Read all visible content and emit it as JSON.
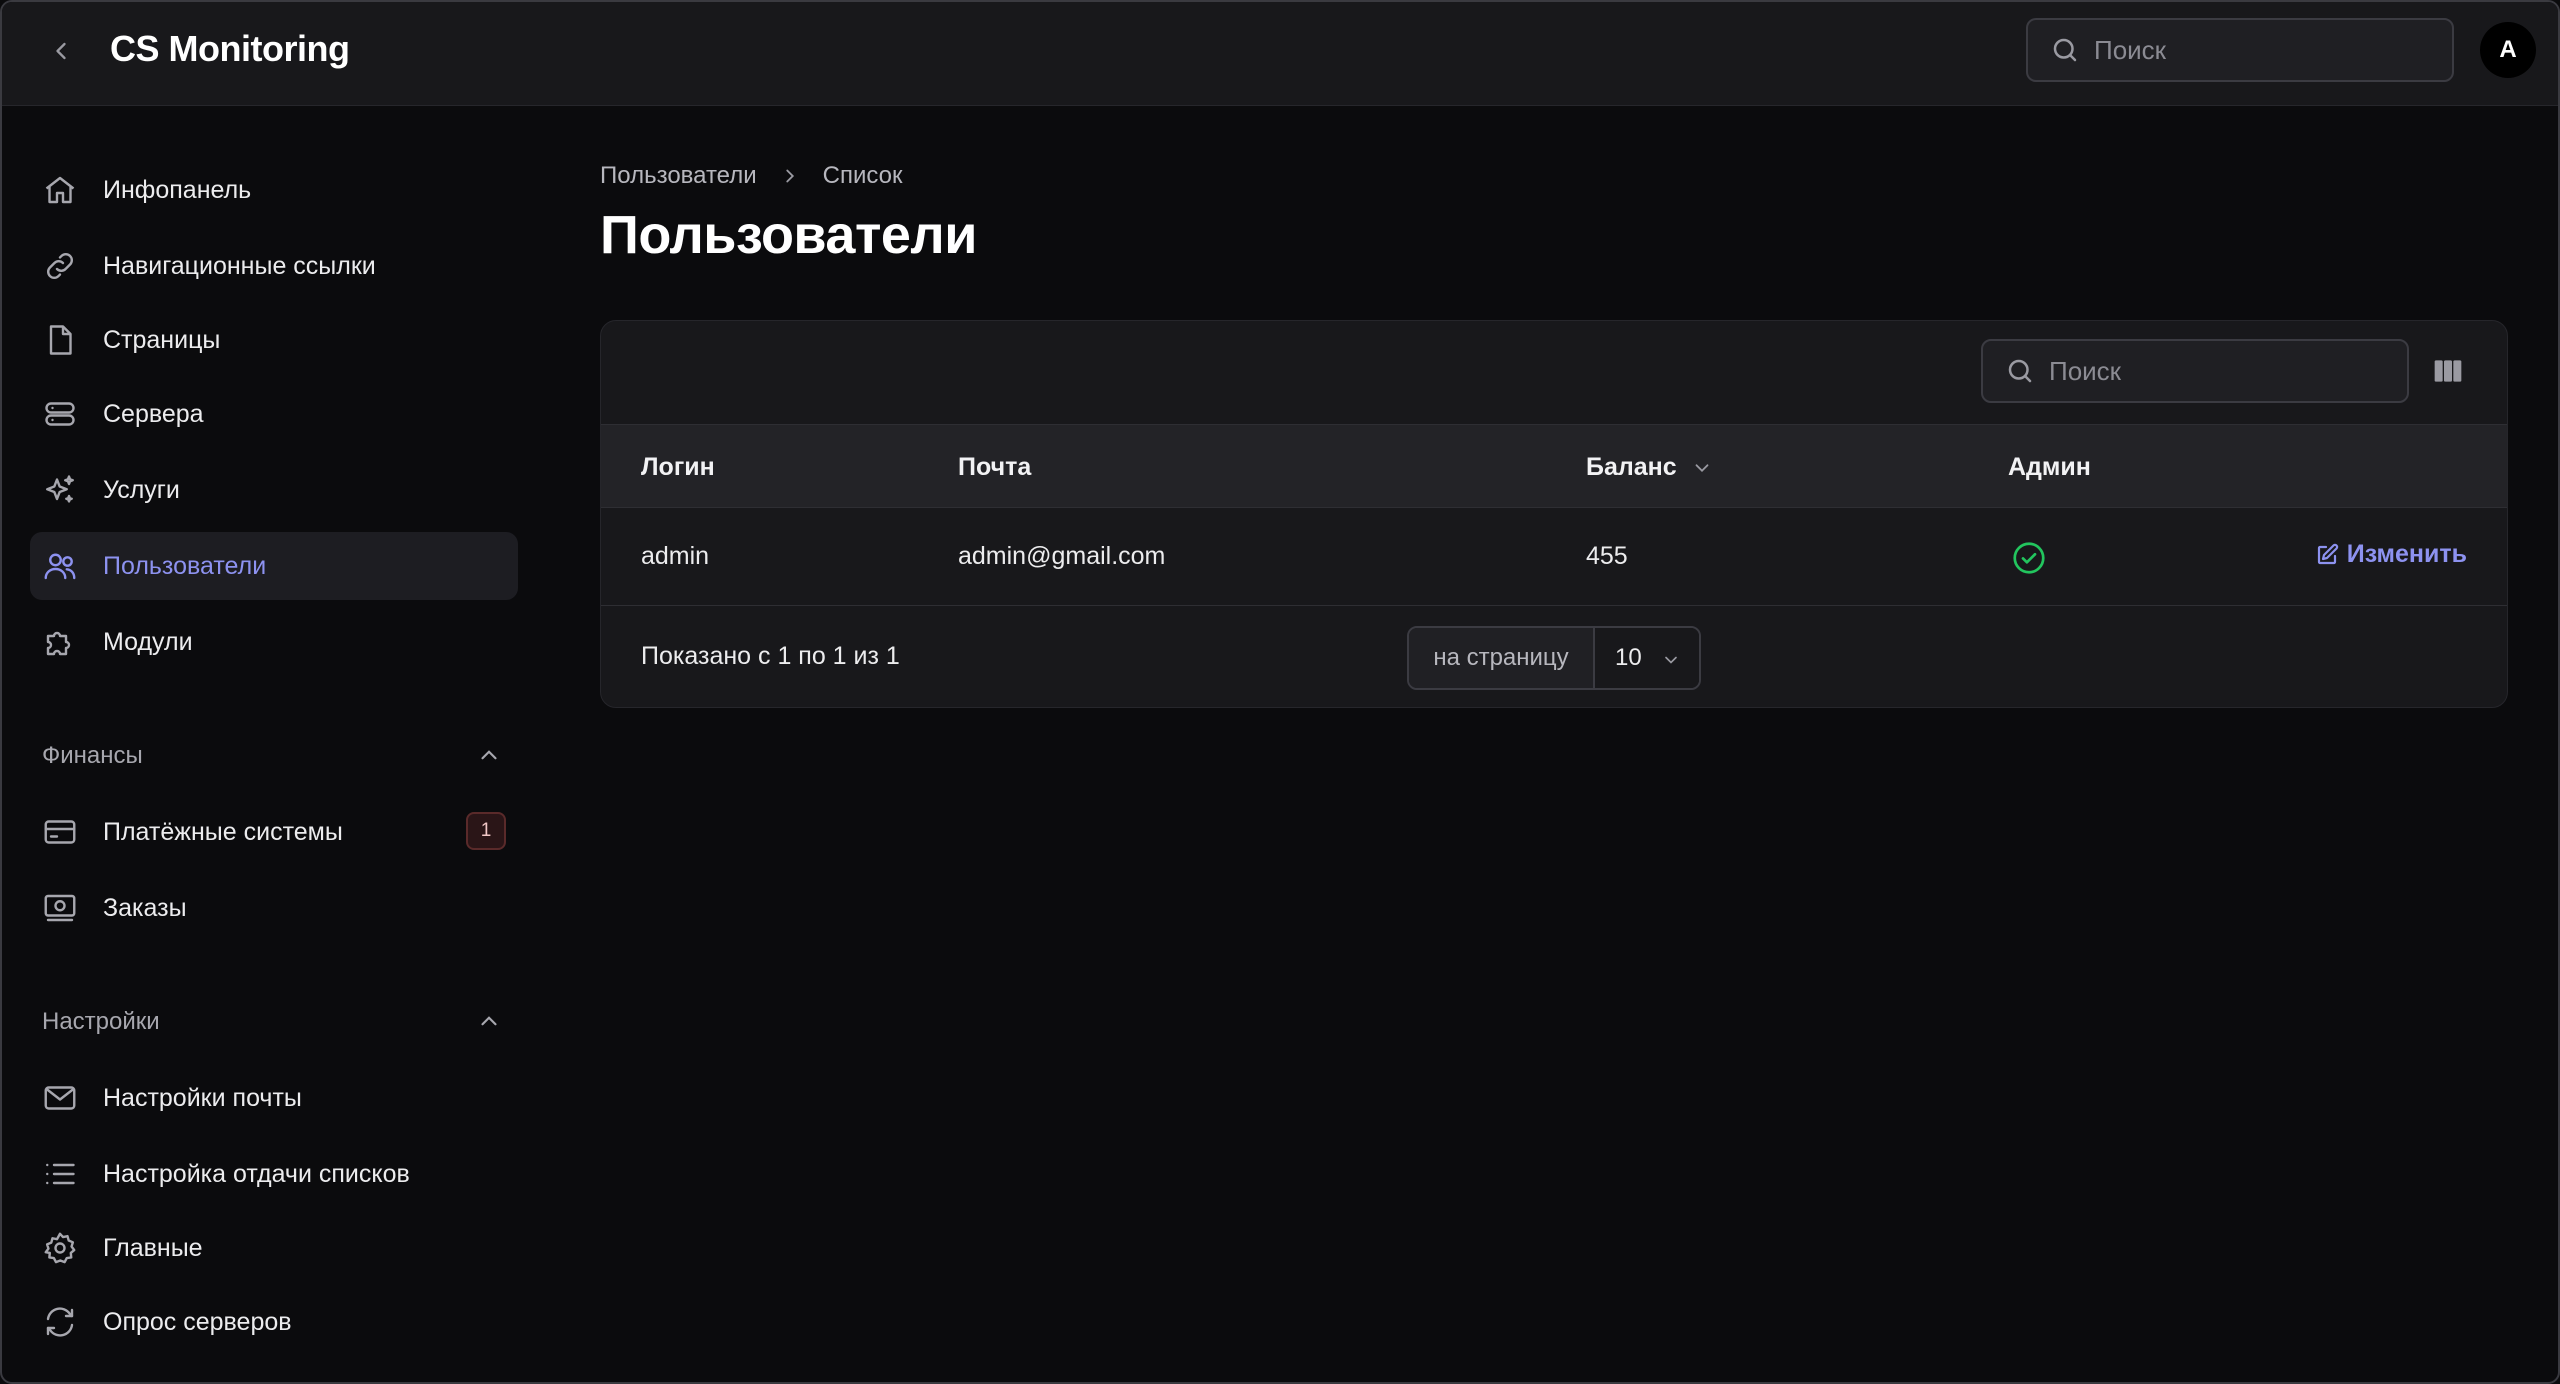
{
  "app": {
    "title": "CS Monitoring",
    "avatar_letter": "A"
  },
  "topbar": {
    "search_placeholder": "Поиск"
  },
  "sidebar": {
    "items": [
      {
        "label": "Инфопанель",
        "icon": "home-icon"
      },
      {
        "label": "Навигационные ссылки",
        "icon": "link-icon"
      },
      {
        "label": "Страницы",
        "icon": "file-icon"
      },
      {
        "label": "Сервера",
        "icon": "server-icon"
      },
      {
        "label": "Услуги",
        "icon": "sparkles-icon"
      },
      {
        "label": "Пользователи",
        "icon": "users-icon",
        "active": true
      },
      {
        "label": "Модули",
        "icon": "puzzle-icon"
      }
    ],
    "sections": [
      {
        "title": "Финансы",
        "items": [
          {
            "label": "Платёжные системы",
            "icon": "credit-card-icon",
            "badge": "1"
          },
          {
            "label": "Заказы",
            "icon": "cash-icon"
          }
        ]
      },
      {
        "title": "Настройки",
        "items": [
          {
            "label": "Настройки почты",
            "icon": "mail-icon"
          },
          {
            "label": "Настройка отдачи списков",
            "icon": "list-icon"
          },
          {
            "label": "Главные",
            "icon": "gear-icon"
          },
          {
            "label": "Опрос серверов",
            "icon": "refresh-icon"
          }
        ]
      }
    ]
  },
  "main": {
    "breadcrumb": [
      "Пользователи",
      "Список"
    ],
    "title": "Пользователи",
    "table": {
      "search_placeholder": "Поиск",
      "columns": [
        "Логин",
        "Почта",
        "Баланс",
        "Админ"
      ],
      "rows": [
        {
          "login": "admin",
          "email": "admin@gmail.com",
          "balance": "455",
          "admin": true,
          "action": "Изменить"
        }
      ],
      "footer": {
        "shown": "Показано с 1 по 1 из 1",
        "per_page_label": "на страницу",
        "per_page_value": "10"
      }
    }
  },
  "colors": {
    "accent": "#8d92f0",
    "success": "#22c55e",
    "danger_badge": "#5a2a2a"
  }
}
